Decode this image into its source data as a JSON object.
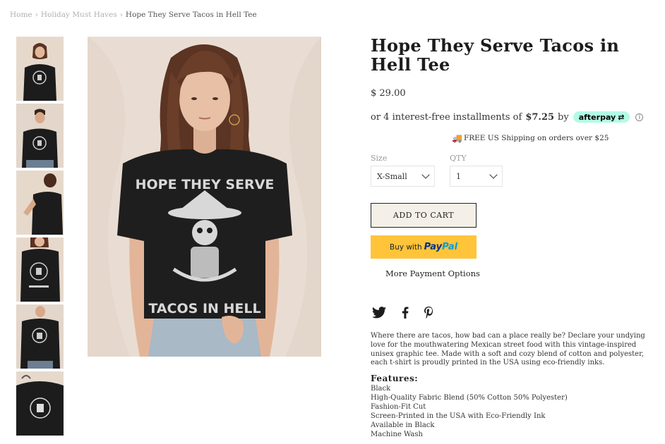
{
  "breadcrumb": {
    "home": "Home",
    "category": "Holiday Must Haves",
    "current": "Hope They Serve Tacos in Hell Tee"
  },
  "product": {
    "title": "Hope They Serve Tacos in Hell Tee",
    "price": "$ 29.00",
    "installments_prefix": "or 4 interest-free installments of",
    "installments_amount": "$7.25",
    "installments_by": "by",
    "afterpay_label": "afterpay",
    "shipping_text": "FREE US Shipping on orders over $25",
    "shirt_print_top": "HOPE THEY SERVE",
    "shirt_print_bottom": "TACOS IN HELL"
  },
  "options": {
    "size_label": "Size",
    "size_value": "X-Small",
    "qty_label": "QTY",
    "qty_value": "1"
  },
  "buttons": {
    "add_to_cart": "ADD TO CART",
    "paypal_prefix": "Buy with",
    "paypal_brand_1": "Pay",
    "paypal_brand_2": "Pal",
    "more_payment": "More Payment Options"
  },
  "social": [
    "twitter-icon",
    "facebook-icon",
    "pinterest-icon"
  ],
  "description": "Where there are tacos, how bad can a place really be? Declare your undying love for the mouthwatering Mexican street food with this vintage-inspired unisex graphic tee. Made with a soft and cozy blend of cotton and polyester, each t-shirt is proudly printed in the USA using eco-friendly inks.",
  "features": {
    "title": "Features:",
    "items": [
      "Black",
      "High-Quality Fabric Blend (50% Cotton 50% Polyester)",
      "Fashion-Fit Cut",
      "Screen-Printed in the USA with Eco-Friendly Ink",
      "Available in Black",
      "Machine Wash"
    ]
  },
  "colors": {
    "afterpay": "#b2fce4",
    "paypal": "#ffc439",
    "cart_bg": "#f4f0e7",
    "photo_bg": "#e9ddd3"
  }
}
